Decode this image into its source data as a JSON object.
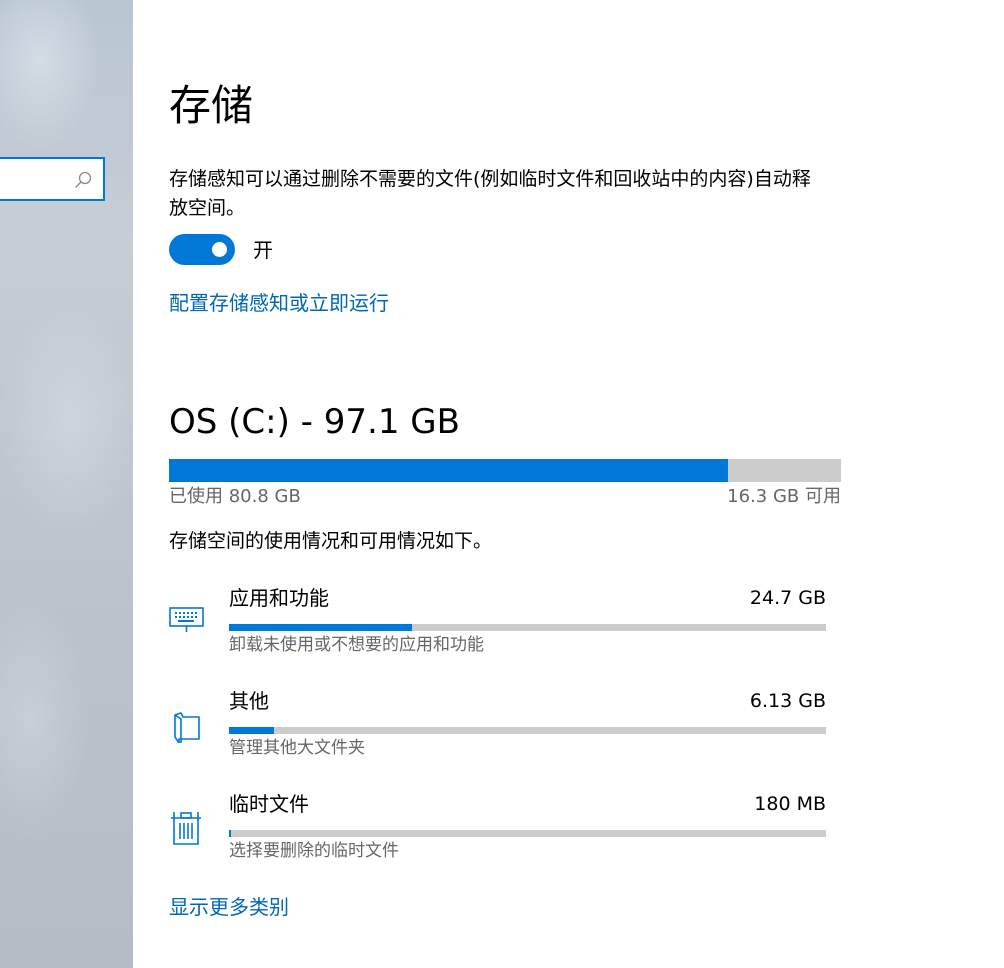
{
  "sidebar": {
    "search": {
      "value": "",
      "placeholder": ""
    }
  },
  "main": {
    "title": "存储",
    "storage_sense": {
      "description": "存储感知可以通过删除不需要的文件(例如临时文件和回收站中的内容)自动释放空间。",
      "toggle_state": "开",
      "toggle_on": true,
      "config_link": "配置存储感知或立即运行"
    },
    "drive": {
      "title": "OS (C:) - 97.1 GB",
      "used_label": "已使用 80.8 GB",
      "free_label": "16.3 GB 可用",
      "used_fraction": 0.832
    },
    "summary": "存储空间的使用情况和可用情况如下。",
    "categories": [
      {
        "name": "应用和功能",
        "size": "24.7 GB",
        "sub": "卸载未使用或不想要的应用和功能",
        "icon": "keyboard-icon",
        "fraction": 0.306
      },
      {
        "name": "其他",
        "size": "6.13 GB",
        "sub": "管理其他大文件夹",
        "icon": "folder-icon",
        "fraction": 0.076
      },
      {
        "name": "临时文件",
        "size": "180 MB",
        "sub": "选择要删除的临时文件",
        "icon": "trash-icon",
        "fraction": 0.003
      }
    ],
    "more_link": "显示更多类别"
  },
  "colors": {
    "accent": "#0078d7",
    "link": "#0067b8",
    "track": "#cccccc",
    "secondary_text": "#666666"
  }
}
